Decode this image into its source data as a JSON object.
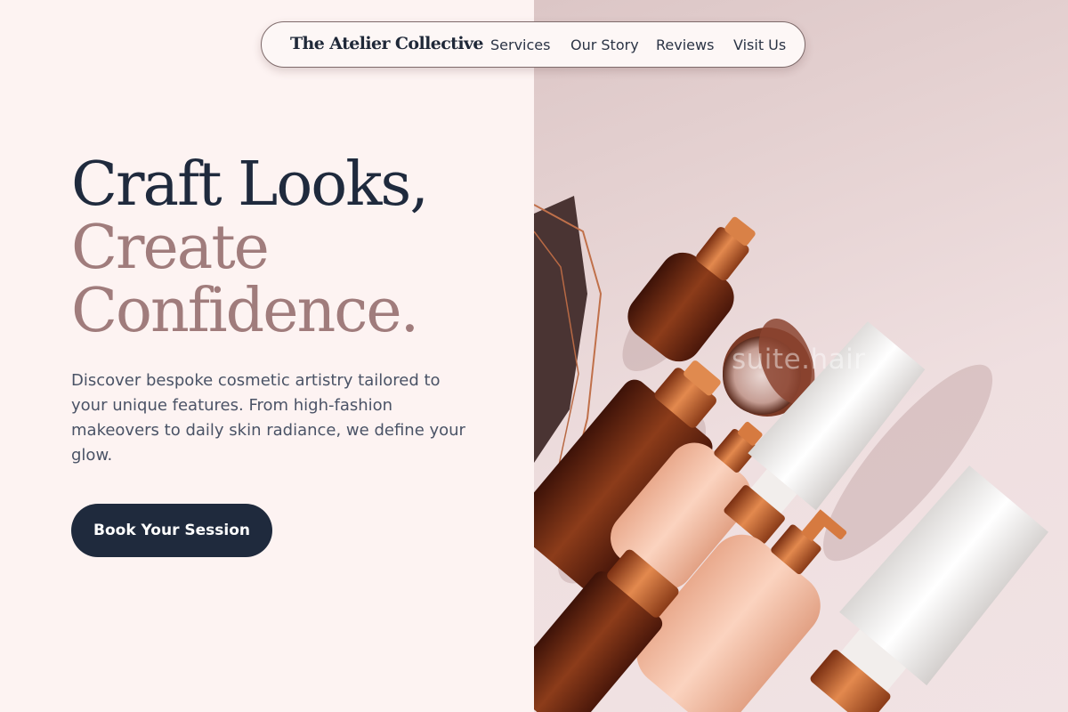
{
  "colors": {
    "page_background": "#fdf3f2",
    "navy": "#1f2a3d",
    "mauve": "#a07c7c",
    "body_text": "#4a5366",
    "copper": "#c66a38",
    "blush_photo_background": "#e6d3d3"
  },
  "navbar": {
    "brand": "The Atelier Collective",
    "links": [
      "Services",
      "Our Story",
      "Reviews",
      "Visit Us"
    ]
  },
  "hero": {
    "headline_line1": "Craft Looks,",
    "headline_line2": "Create",
    "headline_line3": "Confidence.",
    "description": "Discover bespoke cosmetic artistry tailored to your unique features. From high-fashion makeovers to daily skin radiance, we define your glow.",
    "cta_label": "Book Your Session"
  },
  "photo": {
    "watermark": "suite.hair",
    "subject": "cosmetic bottles and tubes flat lay"
  }
}
